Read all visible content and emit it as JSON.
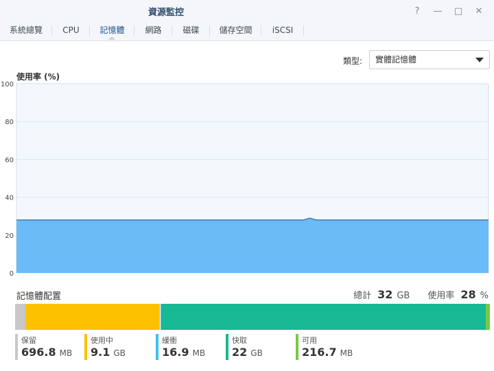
{
  "window": {
    "title": "資源監控"
  },
  "window_buttons": [
    {
      "name": "help",
      "glyph": "?"
    },
    {
      "name": "minimize",
      "glyph": "—"
    },
    {
      "name": "maximize",
      "glyph": "□"
    },
    {
      "name": "close",
      "glyph": "✕"
    }
  ],
  "tabs": [
    {
      "label": "系統總覽",
      "active": false
    },
    {
      "label": "CPU",
      "active": false
    },
    {
      "label": "記憶體",
      "active": true
    },
    {
      "label": "網路",
      "active": false
    },
    {
      "label": "磁碟",
      "active": false
    },
    {
      "label": "儲存空間",
      "active": false
    },
    {
      "label": "iSCSI",
      "active": false
    }
  ],
  "type_filter": {
    "label": "類型:",
    "value": "實體記憶體"
  },
  "usage_chart": {
    "title": "使用率 (%)"
  },
  "chart_data": {
    "type": "area",
    "title": "使用率 (%)",
    "ylim": [
      0,
      100
    ],
    "yticks": [
      0,
      20,
      40,
      60,
      80,
      100
    ],
    "grid": true,
    "fill_color": "#6bbbf6",
    "line_color": "#2f6aa0",
    "series": [
      {
        "values": [
          28,
          28,
          28,
          28,
          28,
          28,
          28,
          28,
          28,
          28,
          28,
          28,
          28,
          28,
          28,
          28,
          28,
          28,
          28,
          28,
          28,
          28,
          28,
          28,
          28,
          28,
          28,
          28,
          28,
          28,
          28,
          28,
          28,
          28,
          28,
          28,
          28,
          28,
          28,
          28,
          28,
          28,
          28,
          28,
          28,
          28,
          29,
          28,
          28,
          28,
          28,
          28,
          28,
          28,
          28,
          28,
          28,
          28,
          28,
          28,
          28,
          28,
          28,
          28,
          28,
          28,
          28,
          28,
          28,
          28,
          28,
          28,
          28,
          28,
          28
        ]
      }
    ]
  },
  "allocation": {
    "title": "記憶體配置",
    "total_label": "總計",
    "total_value": "32",
    "total_unit": "GB",
    "usage_label": "使用率",
    "usage_value": "28",
    "usage_unit": "%",
    "segments": [
      {
        "name": "reserved",
        "fraction": 0.021,
        "color": "#c8c8c8"
      },
      {
        "name": "used",
        "fraction": 0.284,
        "color": "#fdc100"
      },
      {
        "name": "buffer",
        "fraction": 0.003,
        "color": "#3ec2e9"
      },
      {
        "name": "cache",
        "fraction": 0.683,
        "color": "#17b994"
      },
      {
        "name": "available",
        "fraction": 0.009,
        "color": "#7ac943"
      }
    ],
    "legend": [
      {
        "name": "保留",
        "value": "696.8",
        "unit": "MB",
        "color": "#c8c8c8"
      },
      {
        "name": "使用中",
        "value": "9.1",
        "unit": "GB",
        "color": "#fdc100"
      },
      {
        "name": "緩衝",
        "value": "16.9",
        "unit": "MB",
        "color": "#3ec2e9"
      },
      {
        "name": "快取",
        "value": "22",
        "unit": "GB",
        "color": "#17b994"
      },
      {
        "name": "可用",
        "value": "216.7",
        "unit": "MB",
        "color": "#7ac943"
      }
    ]
  }
}
